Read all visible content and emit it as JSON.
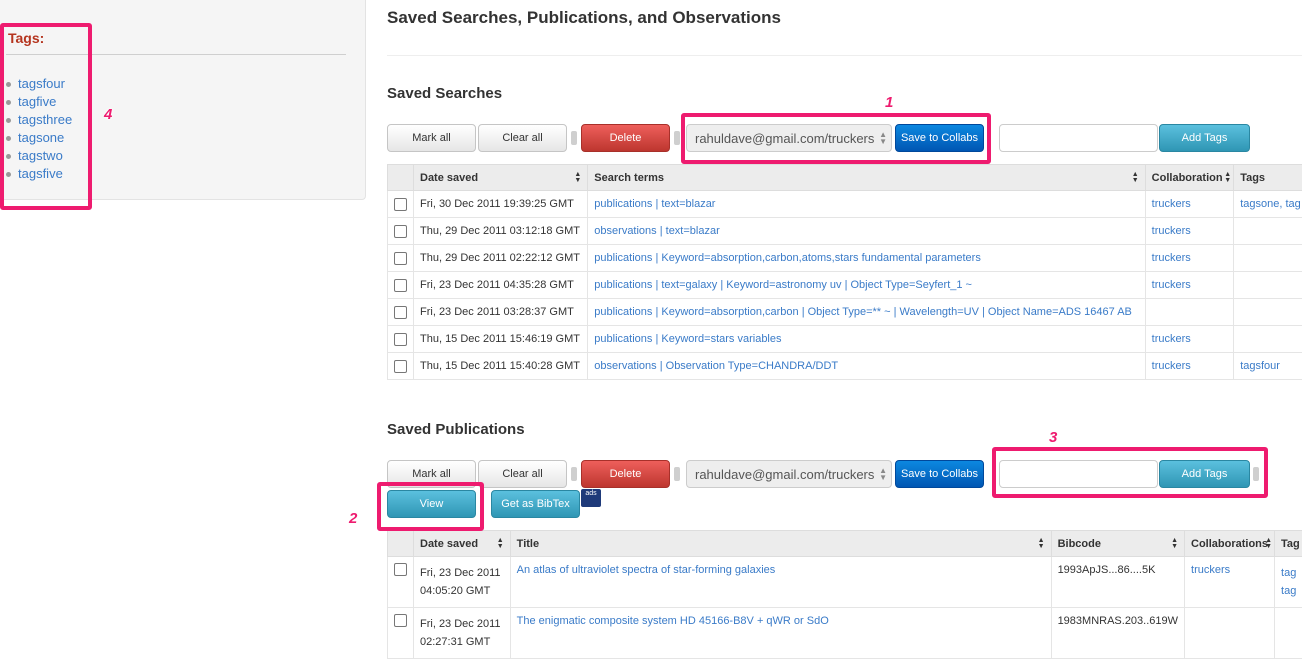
{
  "sidebar": {
    "title": "Tags:",
    "tags": [
      "tagsfour",
      "tagfive",
      "tagsthree",
      "tagsone",
      "tagstwo",
      "tagsfive"
    ]
  },
  "page_title": "Saved Searches, Publications, and Observations",
  "annotations": [
    "1",
    "2",
    "3",
    "4"
  ],
  "saved_searches": {
    "title": "Saved Searches",
    "toolbar": {
      "mark_all": "Mark all",
      "clear_all": "Clear all",
      "delete": "Delete",
      "collab_select": "rahuldave@gmail.com/truckers",
      "save_collabs": "Save to Collabs",
      "tag_input": "",
      "add_tags": "Add Tags"
    },
    "columns": [
      "Date saved",
      "Search terms",
      "Collaboration",
      "Tags"
    ],
    "rows": [
      {
        "date": "Fri, 30 Dec 2011 19:39:25 GMT",
        "terms": "publications | text=blazar",
        "collab": "truckers",
        "tags": "tagsone, tag"
      },
      {
        "date": "Thu, 29 Dec 2011 03:12:18 GMT",
        "terms": "observations | text=blazar",
        "collab": "truckers",
        "tags": ""
      },
      {
        "date": "Thu, 29 Dec 2011 02:22:12 GMT",
        "terms": "publications | Keyword=absorption,carbon,atoms,stars fundamental parameters",
        "collab": "truckers",
        "tags": ""
      },
      {
        "date": "Fri, 23 Dec 2011 04:35:28 GMT",
        "terms": "publications | text=galaxy | Keyword=astronomy uv | Object Type=Seyfert_1 ~",
        "collab": "truckers",
        "tags": ""
      },
      {
        "date": "Fri, 23 Dec 2011 03:28:37 GMT",
        "terms": "publications | Keyword=absorption,carbon | Object Type=** ~ | Wavelength=UV | Object Name=ADS 16467 AB",
        "collab": "",
        "tags": ""
      },
      {
        "date": "Thu, 15 Dec 2011 15:46:19 GMT",
        "terms": "publications | Keyword=stars variables",
        "collab": "truckers",
        "tags": ""
      },
      {
        "date": "Thu, 15 Dec 2011 15:40:28 GMT",
        "terms": "observations | Observation Type=CHANDRA/DDT",
        "collab": "truckers",
        "tags": "tagsfour"
      }
    ]
  },
  "saved_publications": {
    "title": "Saved Publications",
    "toolbar": {
      "mark_all": "Mark all",
      "clear_all": "Clear all",
      "delete": "Delete",
      "collab_select": "rahuldave@gmail.com/truckers",
      "save_collabs": "Save to Collabs",
      "tag_input": "",
      "add_tags": "Add Tags",
      "view": "View",
      "bibtex": "Get as BibTex",
      "ads_icon_text": "ads"
    },
    "columns": [
      "Date saved",
      "Title",
      "Bibcode",
      "Collaborations",
      "Tag"
    ],
    "rows": [
      {
        "date1": "Fri, 23 Dec 2011",
        "date2": "04:05:20 GMT",
        "title": "An atlas of ultraviolet spectra of star-forming galaxies",
        "bibcode": "1993ApJS...86....5K",
        "collab": "truckers",
        "tags1": "tag",
        "tags2": "tag"
      },
      {
        "date1": "Fri, 23 Dec 2011",
        "date2": "02:27:31 GMT",
        "title": "The enigmatic composite system HD 45166-B8V + qWR or SdO",
        "bibcode": "1983MNRAS.203..619W",
        "collab": "",
        "tags1": "",
        "tags2": ""
      }
    ]
  },
  "colors": {
    "annotation": "#ee1b6f",
    "link": "#3a7bc8",
    "tags_title": "#b5351f"
  }
}
